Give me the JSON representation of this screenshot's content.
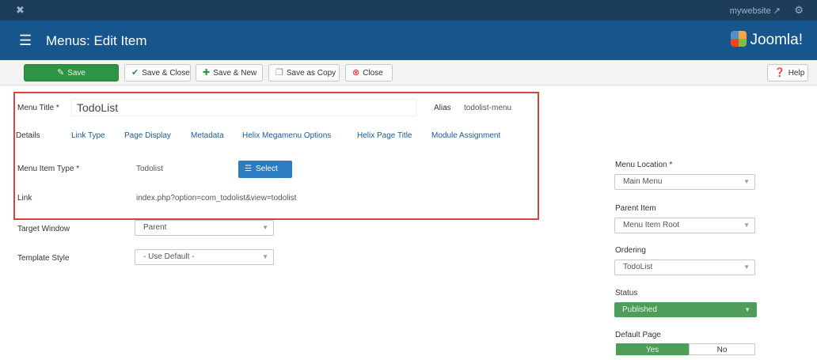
{
  "topbar": {
    "site_link": "mywebsite ↗",
    "joomla_icon": "joomla-icon",
    "settings_icon": "gear-icon"
  },
  "header": {
    "title": "Menus: Edit Item",
    "logo_text": "Joomla!"
  },
  "toolbar": {
    "save": "Save",
    "save_close": "Save & Close",
    "save_new": "Save & New",
    "save_copy": "Save as Copy",
    "close": "Close",
    "help": "Help"
  },
  "form": {
    "menu_title_label": "Menu Title *",
    "menu_title_value": "TodoList",
    "alias_label": "Alias",
    "alias_value": "todolist-menu",
    "tabs": [
      "Details",
      "Link Type",
      "Page Display",
      "Metadata",
      "Helix Megamenu Options",
      "Helix Page Title",
      "Module Assignment"
    ],
    "menu_item_type_label": "Menu Item Type *",
    "menu_item_type_value": "Todolist",
    "select_button": "Select",
    "link_label": "Link",
    "link_value": "index.php?option=com_todolist&view=todolist",
    "target_window_label": "Target Window",
    "target_window_value": "Parent",
    "template_style_label": "Template Style",
    "template_style_value": "- Use Default -"
  },
  "sidebar": {
    "menu_location_label": "Menu Location *",
    "menu_location_value": "Main Menu",
    "parent_item_label": "Parent Item",
    "parent_item_value": "Menu Item Root",
    "ordering_label": "Ordering",
    "ordering_value": "TodoList",
    "status_label": "Status",
    "status_value": "Published",
    "default_page_label": "Default Page",
    "default_yes": "Yes",
    "default_no": "No"
  },
  "colors": {
    "header_bg": "#17568c",
    "topbar_bg": "#1c3d5c",
    "save_green": "#2f9344",
    "select_blue": "#2d7bc0",
    "highlight_red": "#d9433a"
  }
}
